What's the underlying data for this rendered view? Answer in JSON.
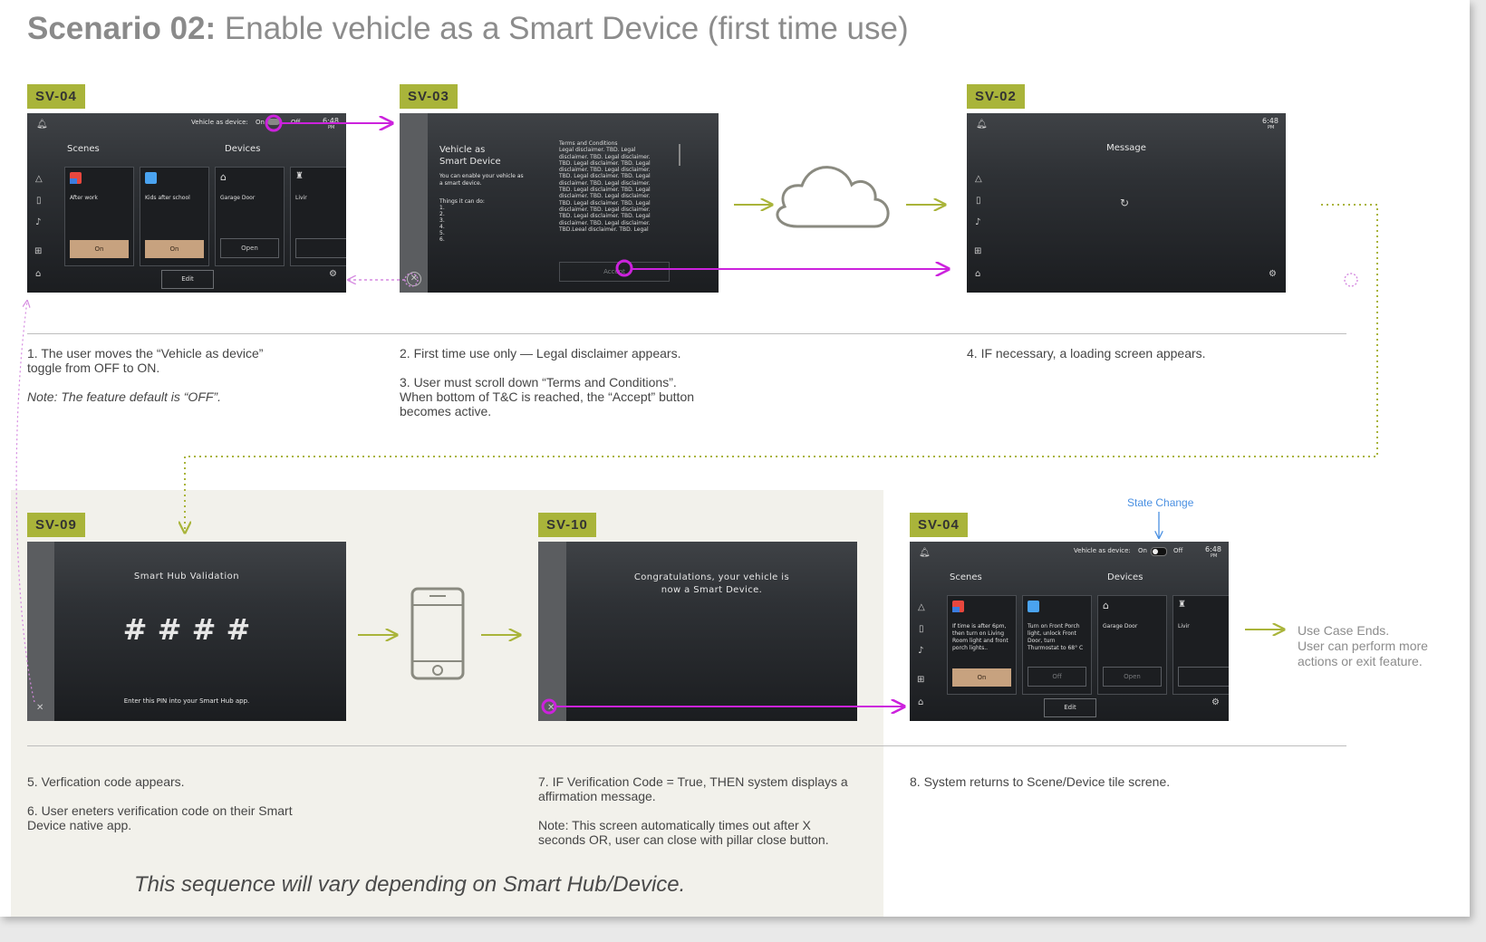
{
  "title": {
    "bold": "Scenario 02:",
    "rest": "Enable vehicle as a Smart Device (first time use)"
  },
  "screens": {
    "sv04a": {
      "tag": "SV-04",
      "toggle_label": "Vehicle as device:",
      "toggle_on": "On",
      "toggle_off": "Off",
      "time": "6:48",
      "ampm": "PM",
      "scenes_heading": "Scenes",
      "devices_heading": "Devices",
      "tiles": [
        {
          "label": "After work",
          "button": "On"
        },
        {
          "label": "Kids after school",
          "button": "On"
        },
        {
          "label": "Garage Door",
          "button": "Open"
        },
        {
          "label": "Livir",
          "button": ""
        }
      ],
      "edit": "Edit"
    },
    "sv03": {
      "tag": "SV-03",
      "heading_line1": "Vehicle as",
      "heading_line2": "Smart Device",
      "intro_line1": "You can enable your vehicle as",
      "intro_line2": "a smart device.",
      "things": "Things it can do:",
      "list": [
        "1.",
        "2.",
        "3.",
        "4.",
        "5.",
        "6."
      ],
      "terms_title": "Terms and Conditions",
      "terms_lines": [
        "Legal disclaimer. TBD. Legal",
        "disclaimer. TBD. Legal disclaimer.",
        "TBD. Legal disclaimer. TBD. Legal",
        "disclaimer. TBD. Legal disclaimer.",
        "TBD. Legal disclaimer. TBD. Legal",
        "disclaimer. TBD. Legal disclaimer.",
        "TBD. Legal disclaimer. TBD. Legal",
        "disclaimer. TBD. Legal disclaimer.",
        "TBD. Legal disclaimer. TBD. Legal",
        "disclaimer. TBD. Legal disclaimer.",
        "TBD. Legal disclaimer. TBD. Legal",
        "disclaimer. TBD. Legal disclaimer.",
        "TBD.Leeal disclaimer. TBD. Legal"
      ],
      "accept": "Accept"
    },
    "sv02": {
      "tag": "SV-02",
      "heading": "Message",
      "time": "6:48",
      "ampm": "PM"
    },
    "sv09": {
      "tag": "SV-09",
      "heading": "Smart Hub Validation",
      "pin": "# # # #",
      "footer": "Enter this PIN into your Smart Hub app."
    },
    "sv10": {
      "tag": "SV-10",
      "line1": "Congratulations, your vehicle is",
      "line2": "now a Smart Device."
    },
    "sv04b": {
      "tag": "SV-04",
      "toggle_label": "Vehicle as device:",
      "toggle_on": "On",
      "toggle_off": "Off",
      "time": "6:48",
      "ampm": "PM",
      "scenes_heading": "Scenes",
      "devices_heading": "Devices",
      "tiles": [
        {
          "label": "If time is after 6pm, then turn on Living Room light and front porch lights..",
          "button": "On"
        },
        {
          "label": "Turn on Front Porch light, unlock Front Door, turn Thurmostat to 68° C",
          "button": "Off"
        },
        {
          "label": "Garage Door",
          "button": "Open"
        },
        {
          "label": "Livir",
          "button": ""
        }
      ],
      "edit": "Edit"
    }
  },
  "captions": {
    "c1": "1. The user moves the “Vehicle as device” toggle from OFF to ON.",
    "c1_note": "Note: The feature default is “OFF”.",
    "c2": "2. First time use only — Legal disclaimer appears.",
    "c3": "3. User must scroll down “Terms and Conditions”. When bottom of T&C is reached, the “Accept” button becomes active.",
    "c4": "4. IF necessary, a loading screen appears.",
    "c5": "5. Verfication code appears.",
    "c6": "6. User eneters verification code on their Smart Device native app.",
    "c7": "7. IF Verification Code = True, THEN system displays a affirmation message.",
    "c7_note": "Note: This screen automatically times out after X seconds OR, user can close with pillar close button.",
    "c8": "8. System returns to Scene/Device tile screne."
  },
  "state_change": "State Change",
  "end_line1": "Use Case Ends.",
  "end_line2": "User can perform more",
  "end_line3": "actions or exit feature.",
  "footnote": "This sequence will vary depending on Smart Hub/Device.",
  "colors": {
    "tag": "#a9b43a",
    "flow_arrow": "#a9b43a",
    "touch": "#cc22dd",
    "state_change": "#4a90e2",
    "on_button": "#c7a27f"
  }
}
